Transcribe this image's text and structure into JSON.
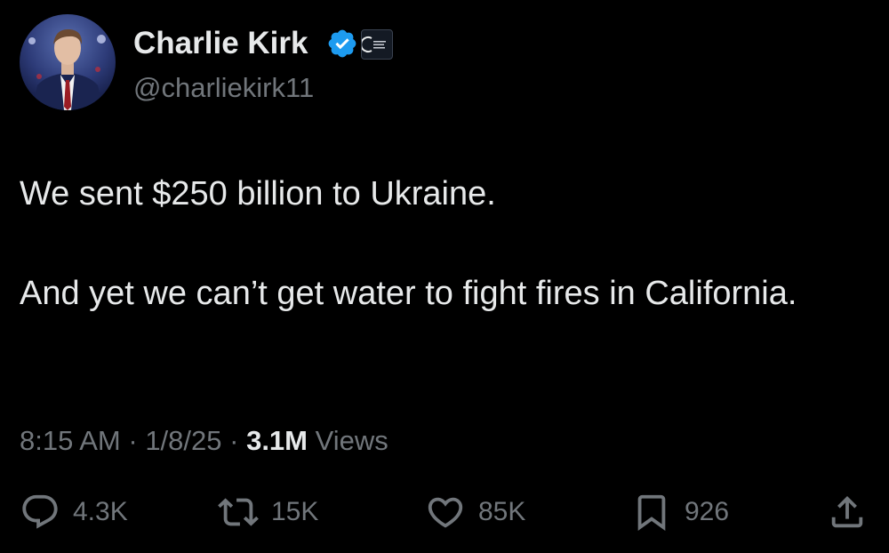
{
  "user": {
    "display_name": "Charlie Kirk",
    "handle": "@charliekirk11",
    "verified_icon": "verified-badge-icon",
    "affiliate_icon": "organization-affiliate-badge-icon"
  },
  "tweet": {
    "paragraph_1": "We sent $250 billion to Ukraine.",
    "paragraph_2": "And yet we can’t get water to fight fires in California."
  },
  "meta": {
    "time": "8:15 AM",
    "separator_1": " · ",
    "date": "1/8/25",
    "separator_2": " · ",
    "views_count": "3.1M",
    "views_label": " Views"
  },
  "actions": {
    "reply": {
      "icon": "reply-icon",
      "count": "4.3K"
    },
    "repost": {
      "icon": "repost-icon",
      "count": "15K"
    },
    "like": {
      "icon": "heart-icon",
      "count": "85K"
    },
    "bookmark": {
      "icon": "bookmark-icon",
      "count": "926"
    },
    "share": {
      "icon": "share-icon"
    }
  },
  "colors": {
    "background": "#000000",
    "primary_text": "#e7e9ea",
    "secondary_text": "#71767b",
    "verified_blue": "#1d9bf0"
  }
}
